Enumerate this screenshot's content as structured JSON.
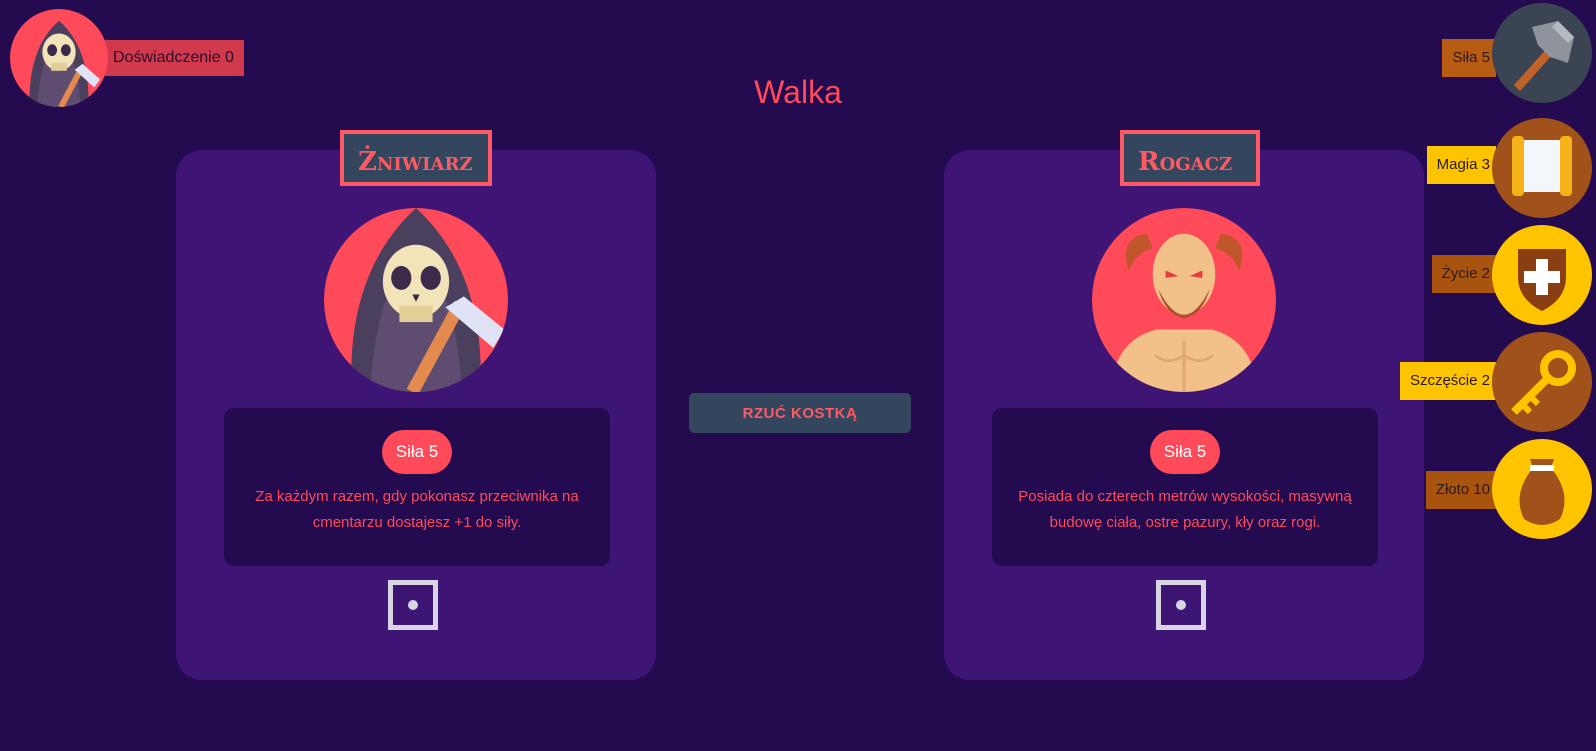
{
  "player": {
    "avatar_icon": "grim-reaper-icon",
    "experience_label": "Doświadczenie 0"
  },
  "page_title": "Walka",
  "fight": {
    "roll_button_label": "RZUĆ KOSTKĄ",
    "player_card": {
      "name": "Żniwiarz",
      "portrait_icon": "grim-reaper-icon",
      "strength_label": "Siła 5",
      "description": "Za każdym razem, gdy pokonasz przeciwnika na cmentarzu dostajesz +1 do siły.",
      "die_value": 1
    },
    "enemy_card": {
      "name": "Rogacz",
      "portrait_icon": "horned-demon-icon",
      "strength_label": "Siła 5",
      "description": "Posiada do czterech metrów wysokości, masywną budowę ciała, ostre pazury, kły oraz rogi.",
      "die_value": 1
    }
  },
  "stats": [
    {
      "label": "Siła 5",
      "icon": "hammer-icon",
      "label_color": "#b85c14"
    },
    {
      "label": "Magia 3",
      "icon": "scroll-icon",
      "label_color": "#ffc400"
    },
    {
      "label": "Życie 2",
      "icon": "shield-icon",
      "label_color": "#a8540f"
    },
    {
      "label": "Szczęście 2",
      "icon": "key-icon",
      "label_color": "#ffc400"
    },
    {
      "label": "Złoto 10",
      "icon": "money-bag-icon",
      "label_color": "#a8540f"
    }
  ],
  "colors": {
    "background": "#240a4e",
    "card": "#3e1475",
    "accent": "#ff4a5a",
    "button": "#34465e"
  }
}
